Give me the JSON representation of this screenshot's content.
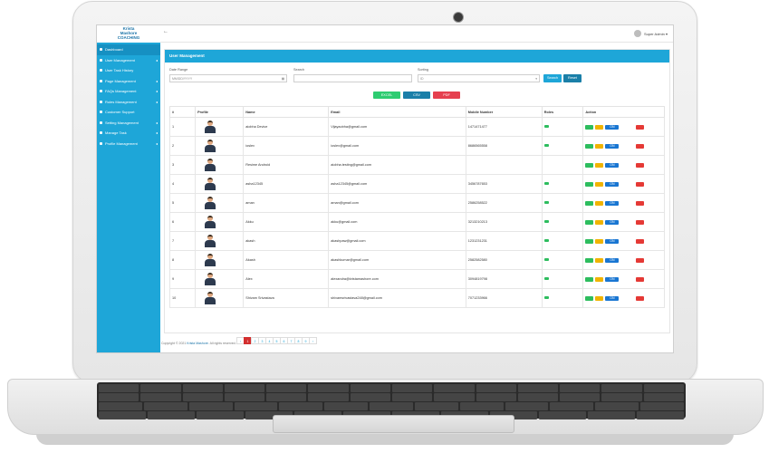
{
  "app": {
    "brand_line1": "Krista",
    "brand_line2": "Mashore",
    "brand_line3": "COACHING"
  },
  "sidebar": {
    "items": [
      {
        "label": "Dashboard",
        "caret": ""
      },
      {
        "label": "User Management",
        "caret": "◂"
      },
      {
        "label": "User Task History",
        "caret": ""
      },
      {
        "label": "Page Management",
        "caret": "◂"
      },
      {
        "label": "FAQs Management",
        "caret": "◂"
      },
      {
        "label": "Rules Management",
        "caret": "◂"
      },
      {
        "label": "Customer Support",
        "caret": ""
      },
      {
        "label": "Setting Management",
        "caret": "◂"
      },
      {
        "label": "Manage Task",
        "caret": "◂"
      },
      {
        "label": "Profile Management",
        "caret": "◂"
      }
    ]
  },
  "topbar": {
    "back_icon": "←",
    "user_label": "Super Admin ▾"
  },
  "panel": {
    "title": "User Management"
  },
  "filters": {
    "date_label": "Date Range",
    "date_placeholder": "MM/DD/YYYY",
    "search_label": "Search",
    "search_value": "",
    "sorting_label": "Sorting",
    "sorting_value": "ID",
    "search_button": "Search",
    "reset_button": "Reset"
  },
  "export": {
    "excel": "EXCEL",
    "csv": "CSV",
    "pdf": "PDF"
  },
  "table": {
    "headers": [
      "#",
      "Profile",
      "Name",
      "Email",
      "Mobile Number",
      "Roles",
      "Action"
    ],
    "on_label": "ON",
    "rows": [
      {
        "num": "1",
        "name": "aiobha Device",
        "email": "Vijayaobha@gmail.com",
        "mobile": "1471471477"
      },
      {
        "num": "2",
        "name": "ioslev",
        "email": "ioslev@gmail.com",
        "mobile": "8686565558"
      },
      {
        "num": "3",
        "name": "Resime Android",
        "email": "aiobha.testing@gmail.com",
        "mobile": ""
      },
      {
        "num": "4",
        "name": "asha12345",
        "email": "asha12345@gmail.com",
        "mobile": "3456787653"
      },
      {
        "num": "5",
        "name": "aman",
        "email": "aman@gmail.com",
        "mobile": "2586258522"
      },
      {
        "num": "6",
        "name": "Akku",
        "email": "akku@gmail.com",
        "mobile": "3213210213"
      },
      {
        "num": "7",
        "name": "akash",
        "email": "akashpaw@gmail.com",
        "mobile": "1231231231"
      },
      {
        "num": "8",
        "name": "Akash",
        "email": "akashkumar@gmail.com",
        "mobile": "2582582580"
      },
      {
        "num": "9",
        "name": "Alex",
        "email": "alexandra@kristamashore.com",
        "mobile": "3094819798"
      },
      {
        "num": "10",
        "name": "Shivam Srivastava",
        "email": "shivamsrivastava248@gmail.com",
        "mobile": "7071233966"
      }
    ]
  },
  "pagination": {
    "prev": "‹",
    "pages": [
      "1",
      "2",
      "3",
      "4",
      "5",
      "6",
      "7",
      "8",
      "9"
    ],
    "next": "›",
    "current": "1"
  },
  "footer": {
    "prefix": "Copyright © 2021",
    "brand": "Krista Mashore.",
    "suffix": "All rights reserved."
  },
  "colors": {
    "accent": "#1ea6d8",
    "excel": "#2ecc71",
    "csv": "#1a7fa8",
    "pdf": "#e5404f",
    "view": "#2dbd5e",
    "edit": "#f0b400",
    "toggle": "#1976d2",
    "delete": "#e53935"
  }
}
